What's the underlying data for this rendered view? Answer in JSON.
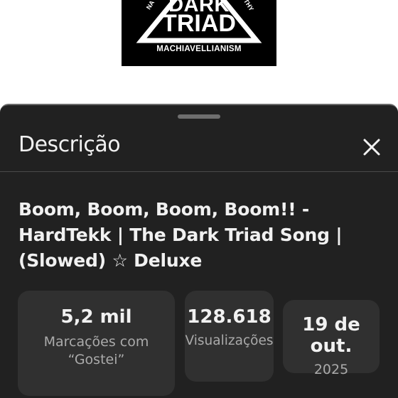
{
  "thumbnail": {
    "logo_top_word": "DARK",
    "logo_main_word": "TRIAD",
    "logo_bottom_word": "MACHIAVELLIANISM",
    "logo_left_fragment": "NA",
    "logo_right_fragment": "THY"
  },
  "sheet": {
    "title": "Descrição",
    "close_icon": "close-icon",
    "video_title": "Boom, Boom, Boom, Boom!! - HardTekk | The Dark Triad Song | (Slowed) ☆ Deluxe"
  },
  "stats": {
    "likes": {
      "value": "5,2 mil",
      "label_line1": "Marcações com",
      "label_line2": "“Gostei”"
    },
    "views": {
      "value": "128.618",
      "label": "Visualizações"
    },
    "date": {
      "value": "19 de out.",
      "label": "2025"
    }
  },
  "colors": {
    "sheet_background": "#212121",
    "card_background": "#303030",
    "primary_text": "#f1f1f1",
    "secondary_text": "#aaaaaa"
  }
}
